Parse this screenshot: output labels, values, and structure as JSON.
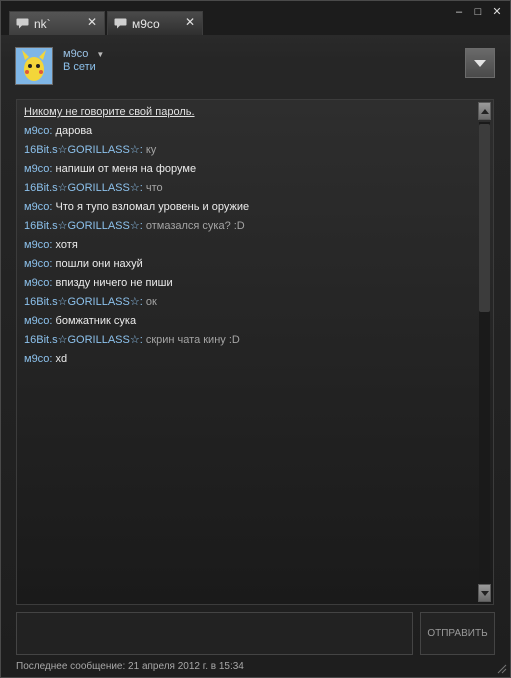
{
  "tabs": [
    {
      "label": "nk`",
      "active": false
    },
    {
      "label": "м9со",
      "active": true
    }
  ],
  "window_controls": {
    "minimize": "–",
    "maximize": "□",
    "close": "✕"
  },
  "header": {
    "username": "м9со",
    "status": "В сети"
  },
  "chat": {
    "warning": "Никому не говорите свой пароль.",
    "messages": [
      {
        "nick": "м9со",
        "text": "дарова",
        "me": true
      },
      {
        "nick": "16Bit.s☆GORILLASS☆",
        "text": "ку",
        "me": false
      },
      {
        "nick": "м9со",
        "text": "напиши от меня на форуме",
        "me": true
      },
      {
        "nick": "16Bit.s☆GORILLASS☆",
        "text": "что",
        "me": false
      },
      {
        "nick": "м9со",
        "text": "Что я тупо взломал уровень и оружие",
        "me": true
      },
      {
        "nick": "16Bit.s☆GORILLASS☆",
        "text": "отмазался сука? :D",
        "me": false
      },
      {
        "nick": "м9со",
        "text": "хотя",
        "me": true
      },
      {
        "nick": "м9со",
        "text": "пошли они нахуй",
        "me": true
      },
      {
        "nick": "м9со",
        "text": "впизду ничего не пиши",
        "me": true
      },
      {
        "nick": "16Bit.s☆GORILLASS☆",
        "text": "ок",
        "me": false
      },
      {
        "nick": "м9со",
        "text": "бомжатник сука",
        "me": true
      },
      {
        "nick": "16Bit.s☆GORILLASS☆",
        "text": "скрин чата кину :D",
        "me": false
      },
      {
        "nick": "м9со",
        "text": "xd",
        "me": true
      }
    ]
  },
  "composer": {
    "value": "",
    "send_label": "ОТПРАВИТЬ"
  },
  "footer": {
    "last_message": "Последнее сообщение: 21 апреля 2012 г. в 15:34"
  },
  "colors": {
    "nick": "#8cc1ec",
    "my_text": "#ececec",
    "other_text": "#a4a4a4",
    "background": "#1e1e1e"
  }
}
